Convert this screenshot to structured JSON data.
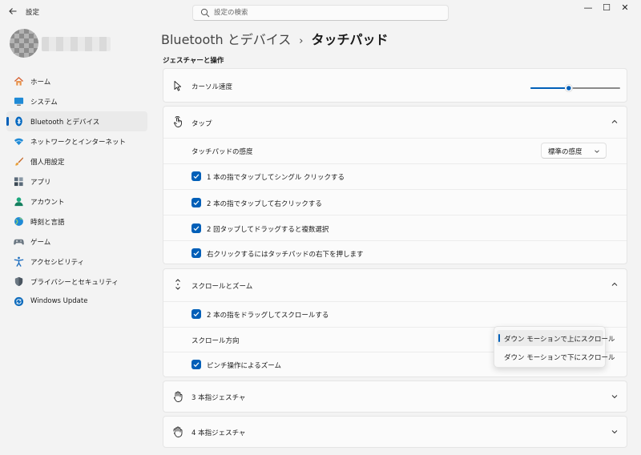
{
  "app": {
    "title": "設定"
  },
  "window_controls": {
    "minimize": "—",
    "maximize": "☐",
    "close": "✕"
  },
  "search": {
    "placeholder": "設定の検索"
  },
  "breadcrumb": {
    "parent": "Bluetooth とデバイス",
    "separator": "›",
    "current": "タッチパッド"
  },
  "sidebar": {
    "items": [
      {
        "label": "ホーム",
        "icon": "home-icon"
      },
      {
        "label": "システム",
        "icon": "system-icon"
      },
      {
        "label": "Bluetooth とデバイス",
        "icon": "bluetooth-icon",
        "active": true
      },
      {
        "label": "ネットワークとインターネット",
        "icon": "wifi-icon"
      },
      {
        "label": "個人用設定",
        "icon": "brush-icon"
      },
      {
        "label": "アプリ",
        "icon": "apps-icon"
      },
      {
        "label": "アカウント",
        "icon": "account-icon"
      },
      {
        "label": "時刻と言語",
        "icon": "globe-icon"
      },
      {
        "label": "ゲーム",
        "icon": "gamepad-icon"
      },
      {
        "label": "アクセシビリティ",
        "icon": "accessibility-icon"
      },
      {
        "label": "プライバシーとセキュリティ",
        "icon": "shield-icon"
      },
      {
        "label": "Windows Update",
        "icon": "windows-update-icon"
      }
    ]
  },
  "main": {
    "section_title": "ジェスチャーと操作",
    "cursor_speed": {
      "label": "カーソル速度",
      "value": 0.42
    },
    "taps": {
      "title": "タップ",
      "sensitivity_label": "タッチパッドの感度",
      "sensitivity_value": "標準の感度",
      "options": [
        {
          "label": "1 本の指でタップしてシングル クリックする",
          "checked": true
        },
        {
          "label": "2 本の指でタップして右クリックする",
          "checked": true
        },
        {
          "label": "2 回タップしてドラッグすると複数選択",
          "checked": true
        },
        {
          "label": "右クリックするにはタッチパッドの右下を押します",
          "checked": true
        }
      ]
    },
    "scroll_zoom": {
      "title": "スクロールとズーム",
      "drag_scroll": {
        "label": "2 本の指をドラッグしてスクロールする",
        "checked": true
      },
      "direction_label": "スクロール方向",
      "pinch_zoom": {
        "label": "ピンチ操作によるズーム",
        "checked": true
      },
      "direction_options": [
        "ダウン モーションで上にスクロール",
        "ダウン モーションで下にスクロール"
      ],
      "direction_selected": 0
    },
    "three_finger": {
      "title": "3 本指ジェスチャ"
    },
    "four_finger": {
      "title": "4 本指ジェスチャ"
    }
  },
  "colors": {
    "accent": "#005fb8",
    "background": "#f3f3f3",
    "card": "#fbfbfb"
  }
}
